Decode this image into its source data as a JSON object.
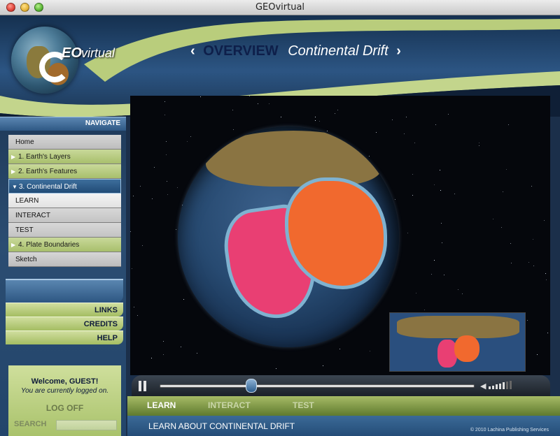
{
  "window": {
    "title": "GEOvirtual"
  },
  "logo": {
    "eo": "EO",
    "virtual": "virtual"
  },
  "heading": {
    "left_arrow": "‹",
    "overview": "OVERVIEW",
    "topic": "Continental Drift",
    "right_arrow": "›"
  },
  "navigate_label": "NAVIGATE",
  "nav": {
    "items": [
      {
        "label": "Home",
        "style": "gray"
      },
      {
        "label": "1. Earth's Layers",
        "style": "green"
      },
      {
        "label": "2. Earth's Features",
        "style": "green"
      },
      {
        "label": "3. Continental Drift",
        "style": "blue"
      },
      {
        "label": "LEARN",
        "style": "sub-active"
      },
      {
        "label": "INTERACT",
        "style": "sub"
      },
      {
        "label": "TEST",
        "style": "sub"
      },
      {
        "label": "4. Plate Boundaries",
        "style": "green"
      },
      {
        "label": "Sketch",
        "style": "gray"
      }
    ]
  },
  "side_links": {
    "links": "LINKS",
    "credits": "CREDITS",
    "help": "HELP"
  },
  "welcome": {
    "hello": "Welcome, GUEST!",
    "status": "You are currently logged on.",
    "logoff": "LOG OFF"
  },
  "search": {
    "label": "SEARCH",
    "value": ""
  },
  "player": {
    "progress": 0.29,
    "volume_level": 5,
    "volume_max": 7
  },
  "tabs": {
    "learn": "LEARN",
    "interact": "INTERACT",
    "test": "TEST"
  },
  "caption": "LEARN ABOUT CONTINENTAL DRIFT",
  "copyright": "© 2010 Lachina Publishing Services",
  "colors": {
    "accent_green": "#a8bf6c",
    "nav_blue": "#214b76",
    "sa_pink": "#e93f73",
    "africa_orange": "#f1692e"
  }
}
